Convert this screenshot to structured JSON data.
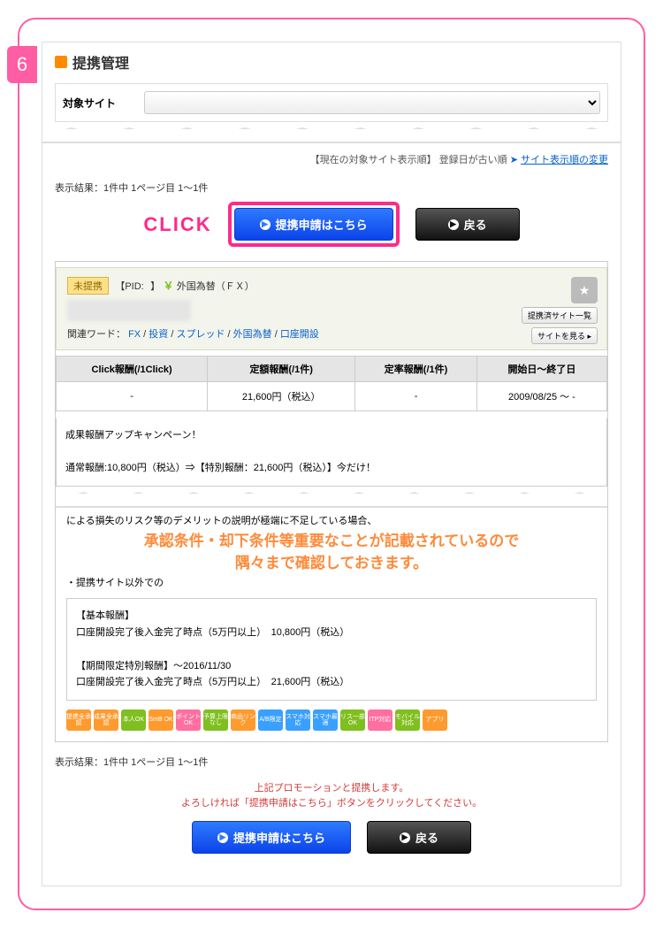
{
  "step": "6",
  "page_title": "提携管理",
  "site_selector": {
    "label": "対象サイト",
    "value": ""
  },
  "sort_line": {
    "prefix": "【現在の対象サイト表示順】",
    "text": "登録日が古い順",
    "link": "サイト表示順の変更"
  },
  "result_line": "表示結果：1件中 1ページ目 1〜1件",
  "buttons": {
    "apply": "提携申請はこちら",
    "back": "戻る"
  },
  "click_label": "CLICK",
  "promo": {
    "status": "未提携",
    "pid_label": "【PID:",
    "pid_suffix": "】",
    "yen": "￥",
    "category": "外国為替（ＦＸ）",
    "keyword_label": "関連ワード：",
    "keywords": [
      "FX",
      "投資",
      "スプレッド",
      "外国為替",
      "口座開設"
    ],
    "side": {
      "list": "提携済サイト一覧",
      "view": "サイトを見る ▸"
    }
  },
  "table": {
    "headers": [
      "Click報酬(/1Click)",
      "定額報酬(/1件)",
      "定率報酬(/1件)",
      "開始日〜終了日"
    ],
    "row": [
      "-",
      "21,600円（税込）",
      "-",
      "2009/08/25 〜 -"
    ]
  },
  "campaign": {
    "title": "成果報酬アップキャンペーン！",
    "line": "通常報酬:10,800円（税込）⇒【特別報酬：21,600円（税込）】今だけ！"
  },
  "overlay_note_1": "承認条件・却下条件等重要なことが記載されているので",
  "overlay_note_2": "隅々まで確認しておきます。",
  "detail": {
    "h1": "【基本報酬】",
    "l1": "口座開設完了後入金完了時点（5万円以上）　10,800円（税込）",
    "h2": "【期間限定特別報酬】〜2016/11/30",
    "l2": "口座開設完了後入金完了時点（5万円以上）　21,600円（税込）"
  },
  "notes_line_1": "による損失のリスク等のデメリットの説明が極端に不足している場合、",
  "notes_line_2": "・提携サイト以外での",
  "tags": [
    "提携全承認",
    "成果全承認",
    "本人OK",
    "SmB OK",
    "ポイントOK",
    "予算上限なし",
    "商品リンク",
    "A/B限定",
    "スマホ対応",
    "スマホ最適",
    "リス一部OK",
    "ITP対応",
    "モバイル対応",
    "アプリ"
  ],
  "footer_msg_1": "上記プロモーションと提携します。",
  "footer_msg_2": "よろしければ「提携申請はこちら」ボタンをクリックしてください。"
}
